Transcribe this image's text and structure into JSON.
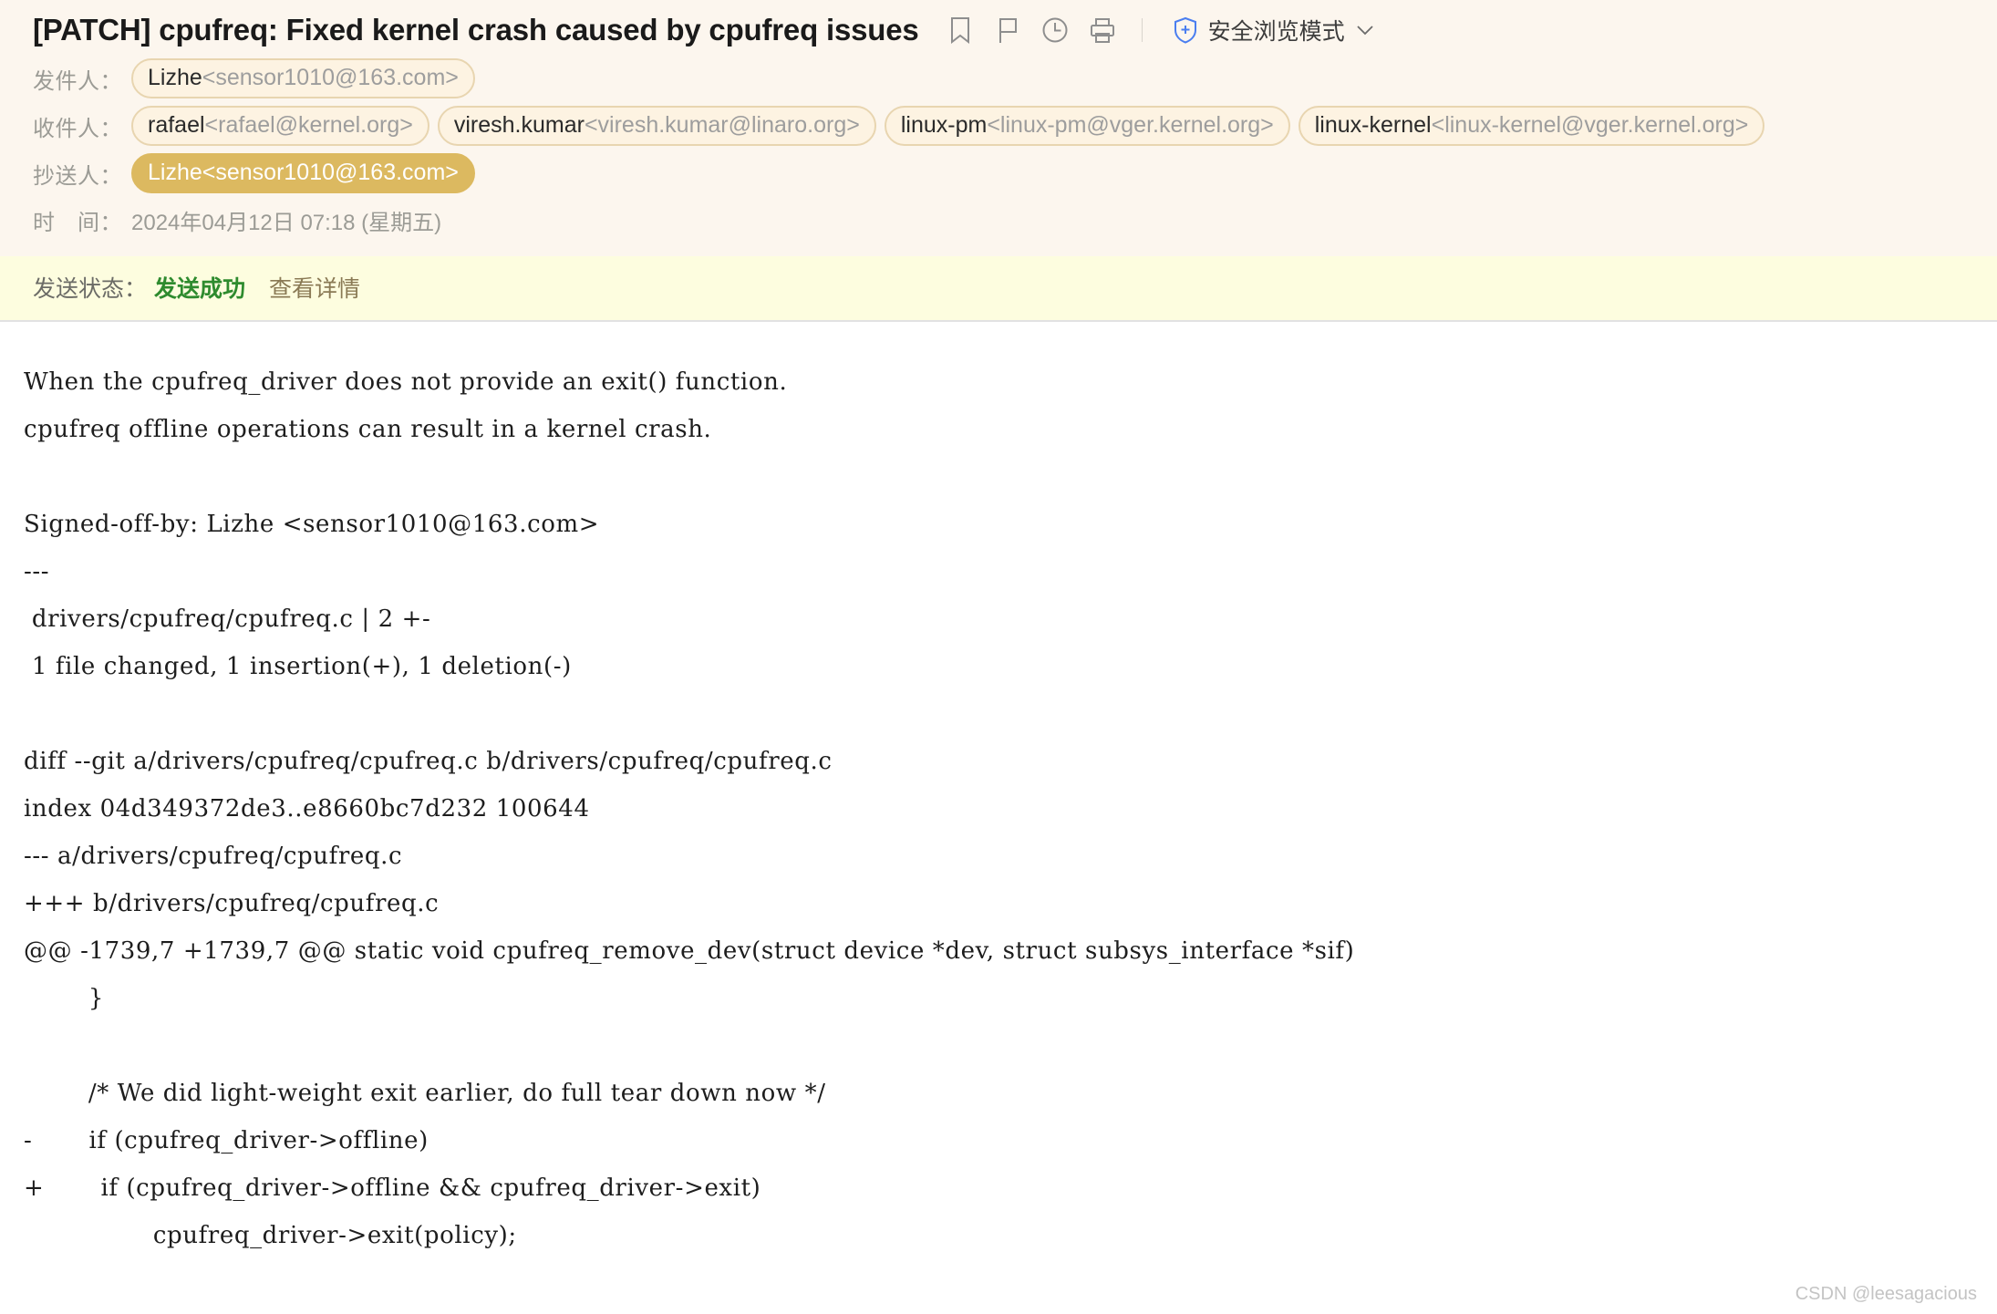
{
  "header": {
    "subject": "[PATCH] cpufreq: Fixed kernel crash caused by cpufreq issues",
    "tools": [
      {
        "name": "bookmark-icon",
        "label": "bookmark"
      },
      {
        "name": "flag-icon",
        "label": "flag"
      },
      {
        "name": "clock-icon",
        "label": "clock"
      },
      {
        "name": "print-icon",
        "label": "print"
      }
    ],
    "safe_mode": {
      "icon": "shield-plus-icon",
      "label": "安全浏览模式",
      "chevron": "⌄"
    }
  },
  "addresses": {
    "from": {
      "label": "发件人：",
      "chips": [
        {
          "name": "Lizhe",
          "email": "<sensor1010@163.com>",
          "filled": false
        }
      ]
    },
    "to": {
      "label": "收件人：",
      "chips": [
        {
          "name": "rafael",
          "email": "<rafael@kernel.org>",
          "filled": false
        },
        {
          "name": "viresh.kumar",
          "email": "<viresh.kumar@linaro.org>",
          "filled": false
        },
        {
          "name": "linux-pm",
          "email": "<linux-pm@vger.kernel.org>",
          "filled": false
        },
        {
          "name": "linux-kernel",
          "email": "<linux-kernel@vger.kernel.org>",
          "filled": false
        }
      ]
    },
    "cc": {
      "label": "抄送人：",
      "chips": [
        {
          "name": "Lizhe",
          "email": "<sensor1010@163.com>",
          "filled": true
        }
      ]
    },
    "date": {
      "label": "时　间：",
      "value": "2024年04月12日 07:18 (星期五)"
    }
  },
  "status": {
    "label": "发送状态：",
    "value": "发送成功",
    "link": "查看详情",
    "success_color": "#2e8b2e",
    "background": "#fdfddf"
  },
  "body": {
    "lines": [
      "When the cpufreq_driver does not provide an exit() function.",
      "cpufreq offline operations can result in a kernel crash.",
      "",
      "Signed-off-by: Lizhe <sensor1010@163.com>",
      "---",
      " drivers/cpufreq/cpufreq.c | 2 +-",
      " 1 file changed, 1 insertion(+), 1 deletion(-)",
      "",
      "diff --git a/drivers/cpufreq/cpufreq.c b/drivers/cpufreq/cpufreq.c",
      "index 04d349372de3..e8660bc7d232 100644",
      "--- a/drivers/cpufreq/cpufreq.c",
      "+++ b/drivers/cpufreq/cpufreq.c",
      "@@ -1739,7 +1739,7 @@ static void cpufreq_remove_dev(struct device *dev, struct subsys_interface *sif)",
      "        }",
      "",
      "        /* We did light-weight exit earlier, do full tear down now */",
      "-       if (cpufreq_driver->offline)",
      "+       if (cpufreq_driver->offline && cpufreq_driver->exit)",
      "                cpufreq_driver->exit(policy);"
    ]
  },
  "watermark": "CSDN @leesagacious",
  "colors": {
    "header_bg": "#fcf6ee",
    "status_bg": "#fdfddf",
    "chip_border": "#e8d5b0",
    "chip_bg": "#fdf3e2",
    "chip_filled_bg": "#dcb960",
    "accent_green": "#2e8b2e",
    "shield_blue": "#4a7ef0"
  }
}
